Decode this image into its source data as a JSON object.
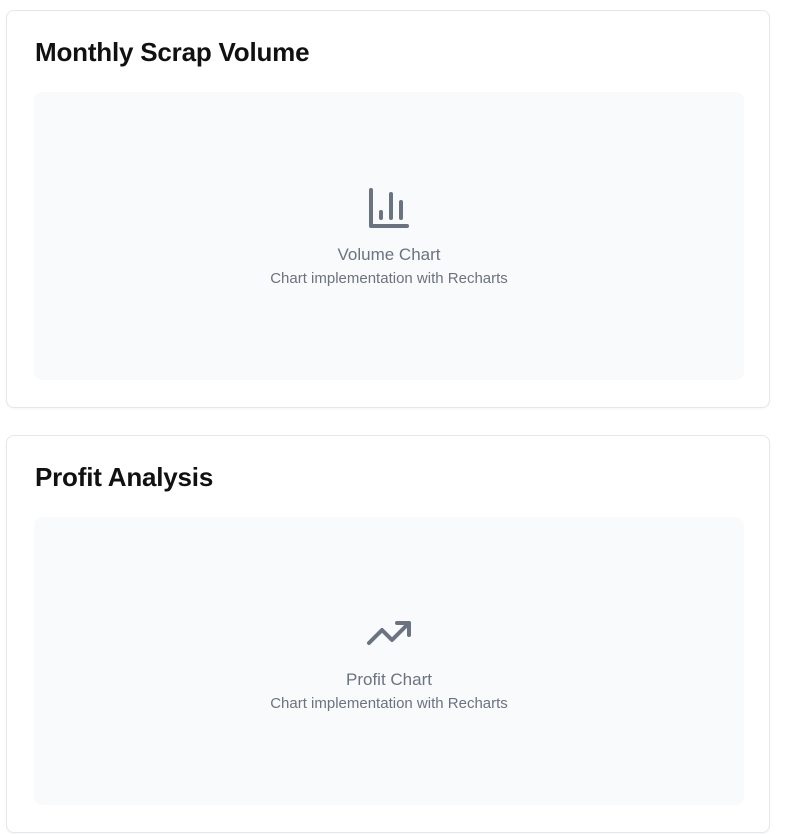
{
  "cards": [
    {
      "title": "Monthly Scrap Volume",
      "placeholder_title": "Volume Chart",
      "placeholder_subtitle": "Chart implementation with Recharts",
      "icon": "bar-chart-icon"
    },
    {
      "title": "Profit Analysis",
      "placeholder_title": "Profit Chart",
      "placeholder_subtitle": "Chart implementation with Recharts",
      "icon": "trending-up-icon"
    }
  ],
  "colors": {
    "icon": "#6b7280",
    "placeholder_bg": "#f9fafb",
    "border": "#e5e7eb"
  }
}
